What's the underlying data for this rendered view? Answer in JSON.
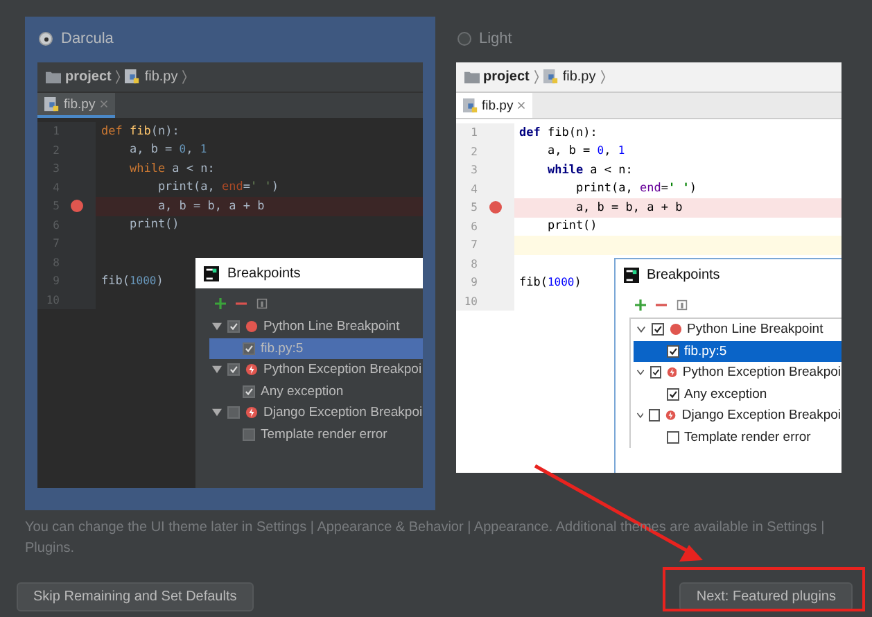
{
  "themes": [
    {
      "name": "Darcula",
      "kind": "dark",
      "selected": true,
      "preview": {
        "breadcrumb": [
          "project",
          "fib.py"
        ],
        "tab": "fib.py",
        "lines": [
          {
            "number": "1",
            "breakpoint": false,
            "tokens": [
              {
                "kind": "kw",
                "text": "def"
              },
              {
                "kind": "fn",
                "text": " fib"
              },
              {
                "kind": "text",
                "text": "(n):"
              }
            ]
          },
          {
            "number": "2",
            "breakpoint": false,
            "tokens": [
              {
                "kind": "text",
                "text": "    a, b = "
              },
              {
                "kind": "num",
                "text": "0"
              },
              {
                "kind": "text",
                "text": ", "
              },
              {
                "kind": "num",
                "text": "1"
              }
            ]
          },
          {
            "number": "3",
            "breakpoint": false,
            "tokens": [
              {
                "kind": "kw",
                "text": "    while"
              },
              {
                "kind": "text",
                "text": " a < n:"
              }
            ]
          },
          {
            "number": "4",
            "breakpoint": false,
            "tokens": [
              {
                "kind": "text",
                "text": "        print(a, "
              },
              {
                "kind": "param",
                "text": "end"
              },
              {
                "kind": "text",
                "text": "="
              },
              {
                "kind": "str",
                "text": "' '"
              },
              {
                "kind": "text",
                "text": ")"
              }
            ]
          },
          {
            "number": "5",
            "breakpoint": true,
            "tokens": [
              {
                "kind": "text",
                "text": "        a, b = b, a + b"
              }
            ]
          },
          {
            "number": "6",
            "breakpoint": false,
            "tokens": [
              {
                "kind": "text",
                "text": "    print()"
              }
            ]
          },
          {
            "number": "7",
            "breakpoint": false
          },
          {
            "number": "8",
            "breakpoint": false
          },
          {
            "number": "9",
            "breakpoint": false,
            "tokens": [
              {
                "kind": "text",
                "text": "fib("
              },
              {
                "kind": "num",
                "text": "1000"
              },
              {
                "kind": "text",
                "text": ")"
              }
            ]
          },
          {
            "number": "10",
            "breakpoint": false
          }
        ],
        "dialog": {
          "title": "Breakpoints",
          "items": [
            {
              "label": "Python Line Breakpoint",
              "kind": "line",
              "checked": true,
              "expanded": true,
              "selected": false,
              "children": [
                {
                  "label": "fib.py:5",
                  "checked": true,
                  "selected": true
                }
              ]
            },
            {
              "label": "Python Exception Breakpoi",
              "kind": "exception",
              "checked": true,
              "expanded": true,
              "selected": false,
              "children": [
                {
                  "label": "Any exception",
                  "checked": true,
                  "selected": false
                }
              ]
            },
            {
              "label": "Django Exception Breakpoi",
              "kind": "exception",
              "checked": false,
              "expanded": true,
              "selected": false,
              "children": [
                {
                  "label": "Template render error",
                  "checked": false,
                  "selected": false
                }
              ]
            }
          ]
        }
      }
    },
    {
      "name": "Light",
      "kind": "light",
      "selected": false,
      "preview": {
        "breadcrumb": [
          "project",
          "fib.py"
        ],
        "tab": "fib.py",
        "lines": [
          {
            "number": "1",
            "breakpoint": false,
            "caret": false,
            "tokens": [
              {
                "kind": "kw",
                "text": "def"
              },
              {
                "kind": "fn",
                "text": " fib"
              },
              {
                "kind": "text",
                "text": "(n):"
              }
            ]
          },
          {
            "number": "2",
            "breakpoint": false,
            "caret": false,
            "tokens": [
              {
                "kind": "text",
                "text": "    a, b = "
              },
              {
                "kind": "num",
                "text": "0"
              },
              {
                "kind": "text",
                "text": ", "
              },
              {
                "kind": "num",
                "text": "1"
              }
            ]
          },
          {
            "number": "3",
            "breakpoint": false,
            "caret": false,
            "tokens": [
              {
                "kind": "kw",
                "text": "    while"
              },
              {
                "kind": "text",
                "text": " a < n:"
              }
            ]
          },
          {
            "number": "4",
            "breakpoint": false,
            "caret": false,
            "tokens": [
              {
                "kind": "text",
                "text": "        print(a, "
              },
              {
                "kind": "param",
                "text": "end"
              },
              {
                "kind": "text",
                "text": "="
              },
              {
                "kind": "str",
                "text": "' '"
              },
              {
                "kind": "text",
                "text": ")"
              }
            ]
          },
          {
            "number": "5",
            "breakpoint": true,
            "caret": false,
            "tokens": [
              {
                "kind": "text",
                "text": "        a, b = b, a + b"
              }
            ]
          },
          {
            "number": "6",
            "breakpoint": false,
            "caret": false,
            "tokens": [
              {
                "kind": "text",
                "text": "    print()"
              }
            ]
          },
          {
            "number": "7",
            "breakpoint": false,
            "caret": true
          },
          {
            "number": "8",
            "breakpoint": false,
            "caret": false
          },
          {
            "number": "9",
            "breakpoint": false,
            "caret": false,
            "tokens": [
              {
                "kind": "text",
                "text": "fib("
              },
              {
                "kind": "num",
                "text": "1000"
              },
              {
                "kind": "text",
                "text": ")"
              }
            ]
          },
          {
            "number": "10",
            "breakpoint": false,
            "caret": false
          }
        ],
        "dialog": {
          "title": "Breakpoints",
          "items": [
            {
              "label": "Python Line Breakpoint",
              "kind": "line",
              "checked": true,
              "expanded": true,
              "selected": false,
              "children": [
                {
                  "label": "fib.py:5",
                  "checked": true,
                  "selected": true
                }
              ]
            },
            {
              "label": "Python Exception Breakpoi",
              "kind": "exception",
              "checked": true,
              "expanded": true,
              "selected": false,
              "children": [
                {
                  "label": "Any exception",
                  "checked": true,
                  "selected": false
                }
              ]
            },
            {
              "label": "Django Exception Breakpoi",
              "kind": "exception",
              "checked": false,
              "expanded": true,
              "selected": false,
              "children": [
                {
                  "label": "Template render error",
                  "checked": false,
                  "selected": false
                }
              ]
            }
          ]
        }
      }
    }
  ],
  "note": "You can change the UI theme later in Settings | Appearance & Behavior | Appearance. Additional themes are available in Settings | Plugins.",
  "buttons": [
    "Skip Remaining and Set Defaults",
    "Next: Featured plugins"
  ]
}
